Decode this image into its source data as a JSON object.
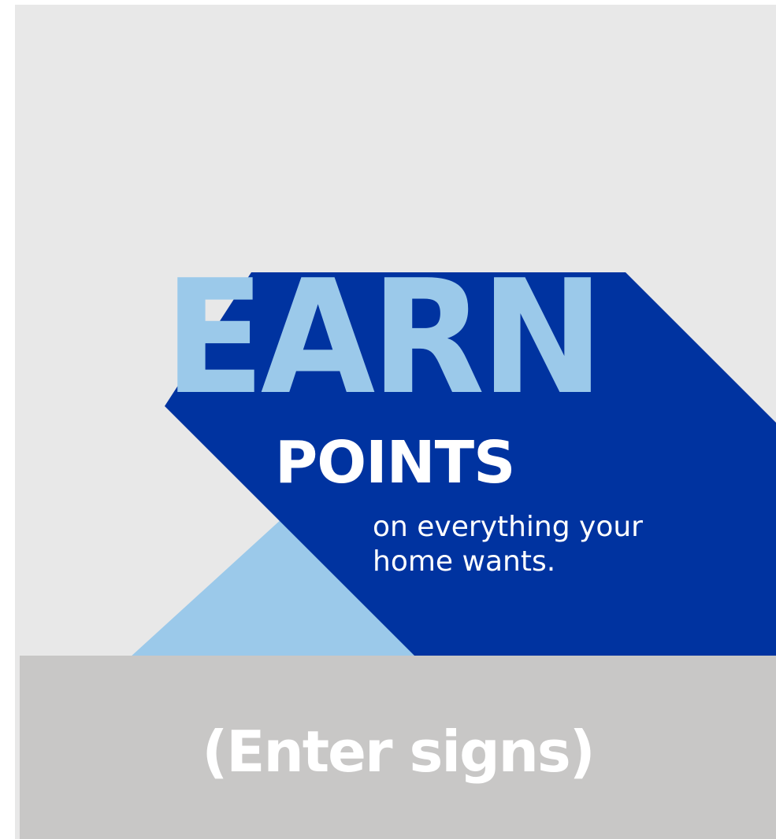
{
  "promo": {
    "headline": "EARN",
    "subhead": "POINTS",
    "tagline_line1": "on everything your",
    "tagline_line2": "home wants.",
    "cta": "(Enter signs)"
  },
  "colors": {
    "background": "#e8e8e8",
    "light_blue": "#9bc9ea",
    "dark_blue": "#0033a0",
    "cta_band": "#c8c7c6",
    "text_white": "#ffffff"
  }
}
